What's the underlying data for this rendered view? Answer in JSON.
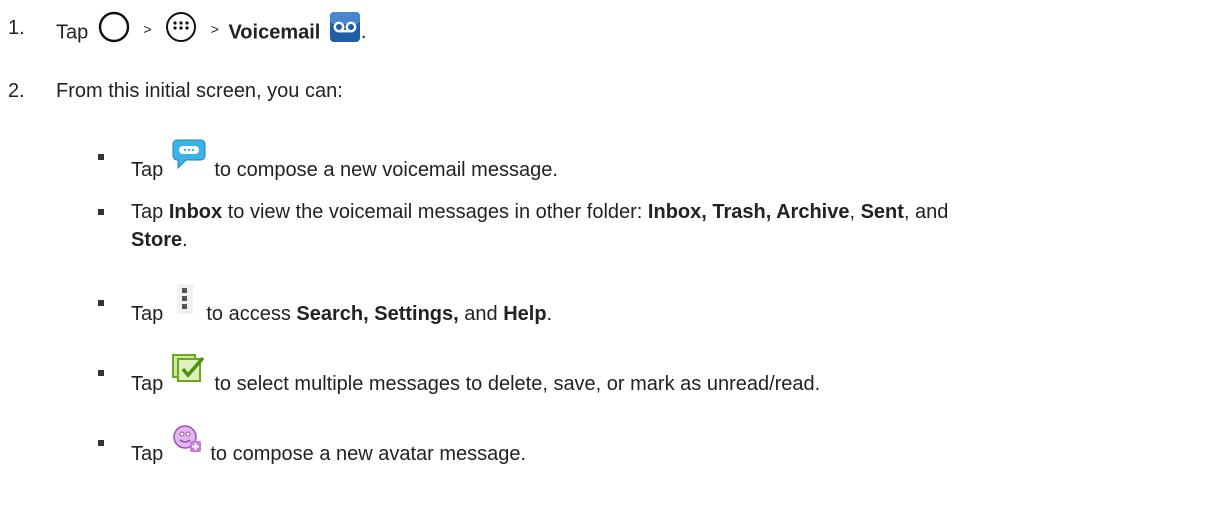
{
  "step1": {
    "number": "1.",
    "tap": "Tap",
    "sep1": ">",
    "sep2": ">",
    "voicemail": "Voicemail",
    "end": ".",
    "icons": [
      "home-circle-icon",
      "apps-grid-icon",
      "voicemail-app-icon"
    ]
  },
  "step2": {
    "number": "2.",
    "text": "From this initial screen, you can:"
  },
  "bullets": {
    "b1": {
      "tap": "Tap",
      "rest": "to compose a new voicemail message.",
      "icon": "compose-bubble-icon"
    },
    "b2": {
      "tap": "Tap",
      "inbox": "Inbox",
      "mid": "to view the voicemail messages in other folder:",
      "folders": "Inbox, Trash, Archive",
      "comma": ",",
      "sent": "Sent",
      "and": ", and",
      "store": "Store",
      "end": "."
    },
    "b3": {
      "tap": "Tap",
      "mid": "to access",
      "search_settings": "Search, Settings,",
      "and": "and",
      "help": "Help",
      "end": ".",
      "icon": "menu-dots-icon"
    },
    "b4": {
      "tap": "Tap",
      "rest": "to select multiple messages to delete, save, or mark as unread/read.",
      "icon": "multi-select-icon"
    },
    "b5": {
      "tap": "Tap",
      "rest": "to compose a new avatar message.",
      "icon": "avatar-add-icon"
    }
  },
  "colors": {
    "voicemail_icon": "#1f5fa8",
    "compose_icon": "#3bb3e6",
    "select_icon": "#7bbf2a",
    "avatar_icon": "#c77ad8"
  }
}
